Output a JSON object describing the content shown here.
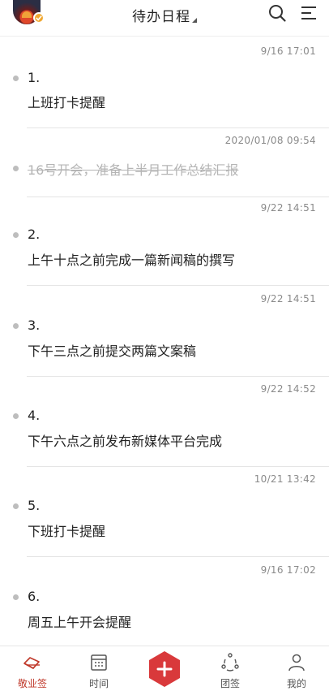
{
  "header": {
    "title": "待办日程"
  },
  "colors": {
    "accent": "#d9393b",
    "text": "#222222",
    "muted": "#8a8a8a",
    "done": "#b5b5b5"
  },
  "items": [
    {
      "time": "9/16 17:01",
      "num": "1.",
      "text": "上班打卡提醒",
      "done": false
    },
    {
      "time": "2020/01/08 09:54",
      "num": "",
      "text": "16号开会，准备上半月工作总结汇报",
      "done": true
    },
    {
      "time": "9/22 14:51",
      "num": "2.",
      "text": "上午十点之前完成一篇新闻稿的撰写",
      "done": false
    },
    {
      "time": "9/22 14:51",
      "num": "3.",
      "text": "下午三点之前提交两篇文案稿",
      "done": false
    },
    {
      "time": "9/22 14:52",
      "num": "4.",
      "text": "下午六点之前发布新媒体平台完成",
      "done": false
    },
    {
      "time": "10/21 13:42",
      "num": "5.",
      "text": "下班打卡提醒",
      "done": false
    },
    {
      "time": "9/16 17:02",
      "num": "6.",
      "text": "周五上午开会提醒",
      "done": false
    }
  ],
  "nav": {
    "items": [
      {
        "label": "敬业签",
        "icon": "note-icon",
        "active": true
      },
      {
        "label": "时间",
        "icon": "calendar-icon",
        "active": false
      },
      {
        "label": "",
        "icon": "add-icon",
        "active": false
      },
      {
        "label": "团签",
        "icon": "team-icon",
        "active": false
      },
      {
        "label": "我的",
        "icon": "profile-icon",
        "active": false
      }
    ]
  }
}
